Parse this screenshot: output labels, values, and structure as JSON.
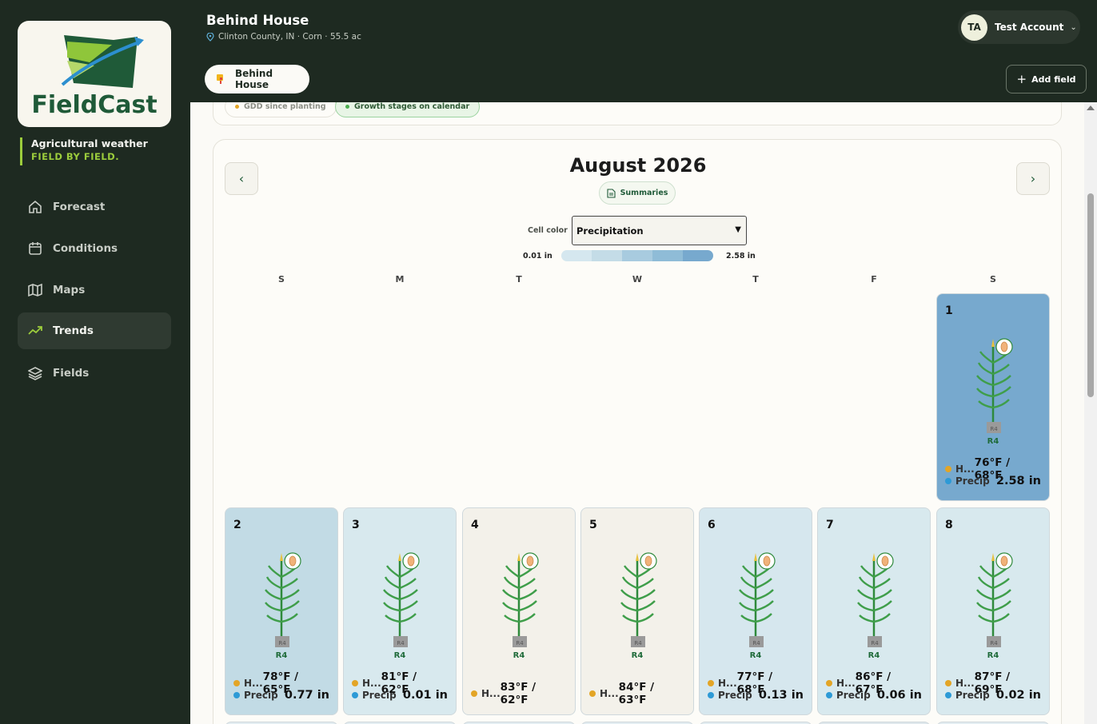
{
  "app": {
    "name": "FieldCast",
    "tagline_1": "Agricultural weather",
    "tagline_2": "FIELD BY FIELD."
  },
  "sidebar": {
    "items": [
      {
        "label": "Forecast",
        "icon": "home-icon"
      },
      {
        "label": "Conditions",
        "icon": "calendar-icon"
      },
      {
        "label": "Maps",
        "icon": "map-icon"
      },
      {
        "label": "Trends",
        "icon": "trend-icon",
        "active": true
      },
      {
        "label": "Fields",
        "icon": "layers-icon"
      }
    ]
  },
  "header": {
    "field_title": "Behind House",
    "field_sub": "Clinton County, IN · Corn · 55.5 ac",
    "account_initials": "TA",
    "account_name": "Test Account",
    "field_tab": "Behind House",
    "add_field": "Add field"
  },
  "chips": {
    "gdd": "GDD since planting",
    "stages": "Growth stages on calendar"
  },
  "calendar": {
    "month": "August 2026",
    "summaries": "Summaries",
    "cell_color_label": "Cell color",
    "cell_color_value": "Precipitation",
    "legend_min": "0.01 in",
    "legend_max": "2.58 in",
    "legend_colors": [
      "#d5e7ef",
      "#c4dce7",
      "#a8cbdf",
      "#8fbcd7",
      "#77a9ce"
    ],
    "dow": [
      "S",
      "M",
      "T",
      "W",
      "T",
      "F",
      "S"
    ],
    "days": [
      {
        "num": "1",
        "stage": "R4",
        "hi_label": "H...",
        "temp": "76°F / 68°F",
        "precip_label": "Precip",
        "precip": "2.58 in",
        "color": "#77a9ce"
      },
      {
        "num": "2",
        "stage": "R4",
        "hi_label": "H...",
        "temp": "78°F / 65°F",
        "precip_label": "Precip",
        "precip": "0.77 in",
        "color": "#c2dbe5"
      },
      {
        "num": "3",
        "stage": "R4",
        "hi_label": "H...",
        "temp": "81°F / 62°F",
        "precip_label": "Precip",
        "precip": "0.01 in",
        "color": "#d8e9ee"
      },
      {
        "num": "4",
        "stage": "R4",
        "hi_label": "H...",
        "temp": "83°F / 62°F",
        "precip_label": "",
        "precip": "",
        "color": "#f3f1ea"
      },
      {
        "num": "5",
        "stage": "R4",
        "hi_label": "H...",
        "temp": "84°F / 63°F",
        "precip_label": "",
        "precip": "",
        "color": "#f3f1ea"
      },
      {
        "num": "6",
        "stage": "R4",
        "hi_label": "H...",
        "temp": "77°F / 68°F",
        "precip_label": "Precip",
        "precip": "0.13 in",
        "color": "#d6e7ee"
      },
      {
        "num": "7",
        "stage": "R4",
        "hi_label": "H...",
        "temp": "86°F / 67°F",
        "precip_label": "Precip",
        "precip": "0.06 in",
        "color": "#d8e9ee"
      },
      {
        "num": "8",
        "stage": "R4",
        "hi_label": "H...",
        "temp": "87°F / 69°F",
        "precip_label": "Precip",
        "precip": "0.02 in",
        "color": "#d8e9ee"
      }
    ]
  }
}
